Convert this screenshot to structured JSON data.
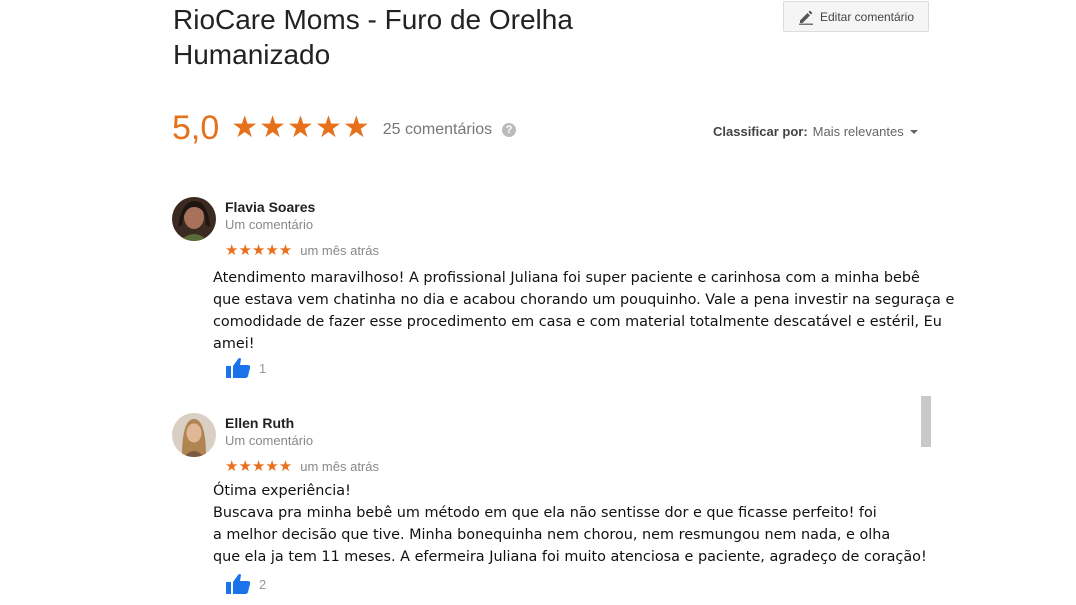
{
  "place": {
    "title": "RioCare Moms - Furo de Orelha Humanizado"
  },
  "header": {
    "edit_label": "Editar comentário"
  },
  "summary": {
    "score": "5,0",
    "stars": "★★★★★",
    "star_rating": 5,
    "count": "25 comentários",
    "help": "?"
  },
  "sort": {
    "label": "Classificar por:",
    "value": "Mais relevantes"
  },
  "colors": {
    "accent": "#e7711b",
    "like": "#1a73e8"
  },
  "reviews": [
    {
      "name": "Flavia Soares",
      "sub": "Um comentário",
      "stars": "★★★★★",
      "rating": 5,
      "when": "um mês atrás",
      "lines": [
        "Atendimento maravilhoso! A profissional Juliana foi super paciente e carinhosa com a minha bebê",
        "que estava vem chatinha no dia e acabou chorando um pouquinho. Vale a pena investir na seguraça e",
        "comodidade de fazer esse procedimento em casa e com material totalmente descatável e estéril, Eu",
        "amei!"
      ],
      "likes": "1"
    },
    {
      "name": "Ellen Ruth",
      "sub": "Um comentário",
      "stars": "★★★★★",
      "rating": 5,
      "when": "um mês atrás",
      "lines": [
        "Ótima experiência!",
        "Buscava pra minha bebê um método em que ela não sentisse dor e que ficasse perfeito! foi",
        "a melhor decisão que tive. Minha bonequinha nem chorou, nem resmungou nem nada, e olha",
        "que ela ja tem 11 meses. A efermeira Juliana foi muito atenciosa e paciente, agradeço de coração!"
      ],
      "likes": "2"
    }
  ]
}
